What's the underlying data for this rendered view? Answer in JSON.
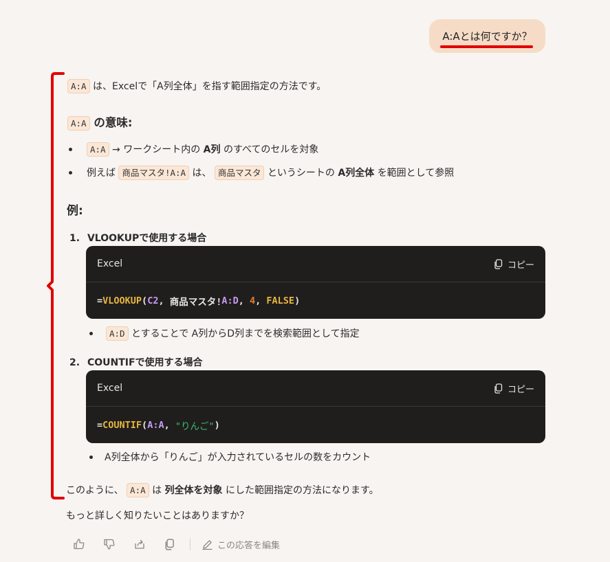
{
  "user_message": "A:Aとは何ですか？",
  "response": {
    "intro": {
      "code": "A:A",
      "text": "は、Excelで「A列全体」を指す範囲指定の方法です。"
    },
    "meaning_heading": {
      "code": "A:A",
      "text": "の意味:"
    },
    "meaning_bullets": [
      {
        "code": "A:A",
        "text_a": "→ ワークシート内の",
        "bold": "A列",
        "text_b": "のすべてのセルを対象"
      },
      {
        "pre": "例えば",
        "code1": "商品マスタ!A:A",
        "mid1": "は、",
        "code2": "商品マスタ",
        "mid2": "というシートの",
        "bold": "A列全体",
        "post": "を範囲として参照"
      }
    ],
    "example_heading": "例:",
    "examples": [
      {
        "num": "1.",
        "title": "VLOOKUPで使用する場合",
        "lang": "Excel",
        "copy_label": "コピー",
        "code_tokens": {
          "t1": "=",
          "t2": "VLOOKUP",
          "t3": "(",
          "t4": "C2",
          "t5": ", ",
          "t6": "商品マスタ!",
          "t7": "A:D",
          "t8": ", ",
          "t9": "4",
          "t10": ", ",
          "t11": "FALSE",
          "t12": ")"
        },
        "note": {
          "code": "A:D",
          "text": "とすることで A列からD列までを検索範囲として指定"
        }
      },
      {
        "num": "2.",
        "title": "COUNTIFで使用する場合",
        "lang": "Excel",
        "copy_label": "コピー",
        "code_tokens": {
          "t1": "=",
          "t2": "COUNTIF",
          "t3": "(",
          "t4": "A:A",
          "t5": ", ",
          "t6": "\"りんご\"",
          "t7": ")"
        },
        "note": {
          "text": "A列全体から「りんご」が入力されているセルの数をカウント"
        }
      }
    ],
    "conclusion": {
      "pre": "このように、",
      "code": "A:A",
      "mid": "は",
      "bold": "列全体を対象",
      "post": "にした範囲指定の方法になります。"
    },
    "followup": "もっと詳しく知りたいことはありますか？"
  },
  "actions": {
    "edit_label": "この応答を編集"
  },
  "colors": {
    "annotation_red": "#e00000",
    "code_bg": "#1f1e1d",
    "bubble": "#f6dcc6"
  }
}
